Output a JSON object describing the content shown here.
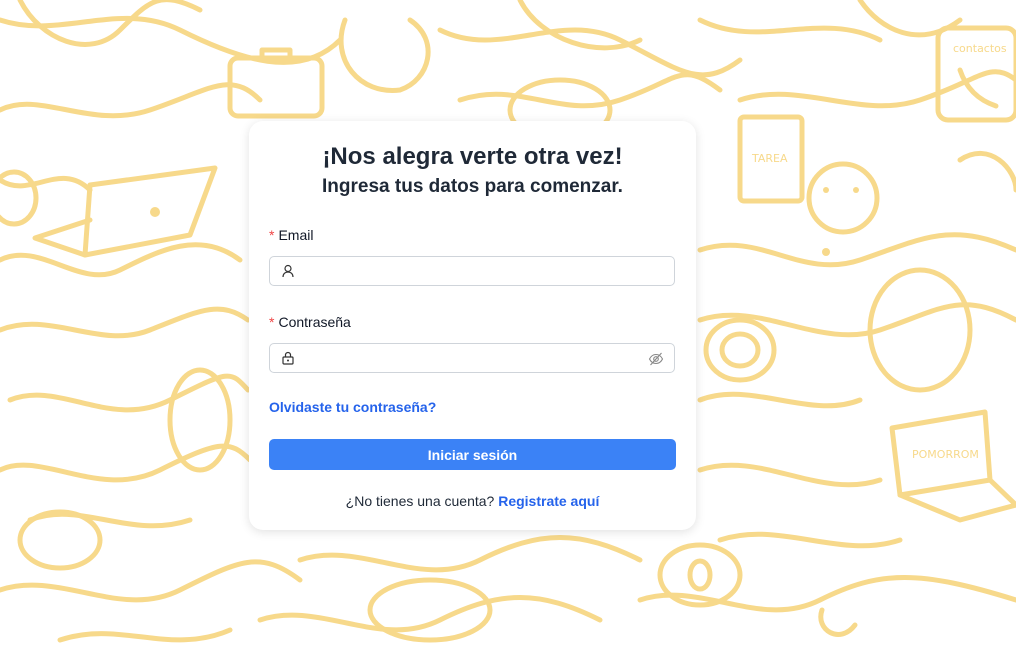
{
  "background": {
    "doodle_color": "#f7d98b",
    "doodle_labels": {
      "contacts": "contactos",
      "task": "TAREA",
      "pomodoro": "POMORROM"
    }
  },
  "login": {
    "title": "¡Nos alegra verte otra vez!",
    "subtitle": "Ingresa tus datos para comenzar.",
    "required_mark": "*",
    "email": {
      "label": "Email",
      "value": "",
      "icon": "user-icon"
    },
    "password": {
      "label": "Contraseña",
      "value": "",
      "icon": "lock-icon",
      "toggle_icon": "eye-off-icon"
    },
    "forgot_link": "Olvidaste tu contraseña?",
    "submit_label": "Iniciar sesión",
    "register_prompt": "¿No tienes una cuenta?",
    "register_link": "Registrate aquí"
  },
  "colors": {
    "primary": "#3b82f6",
    "link": "#2563eb",
    "required": "#ef4444",
    "doodle": "#f7d98b"
  }
}
